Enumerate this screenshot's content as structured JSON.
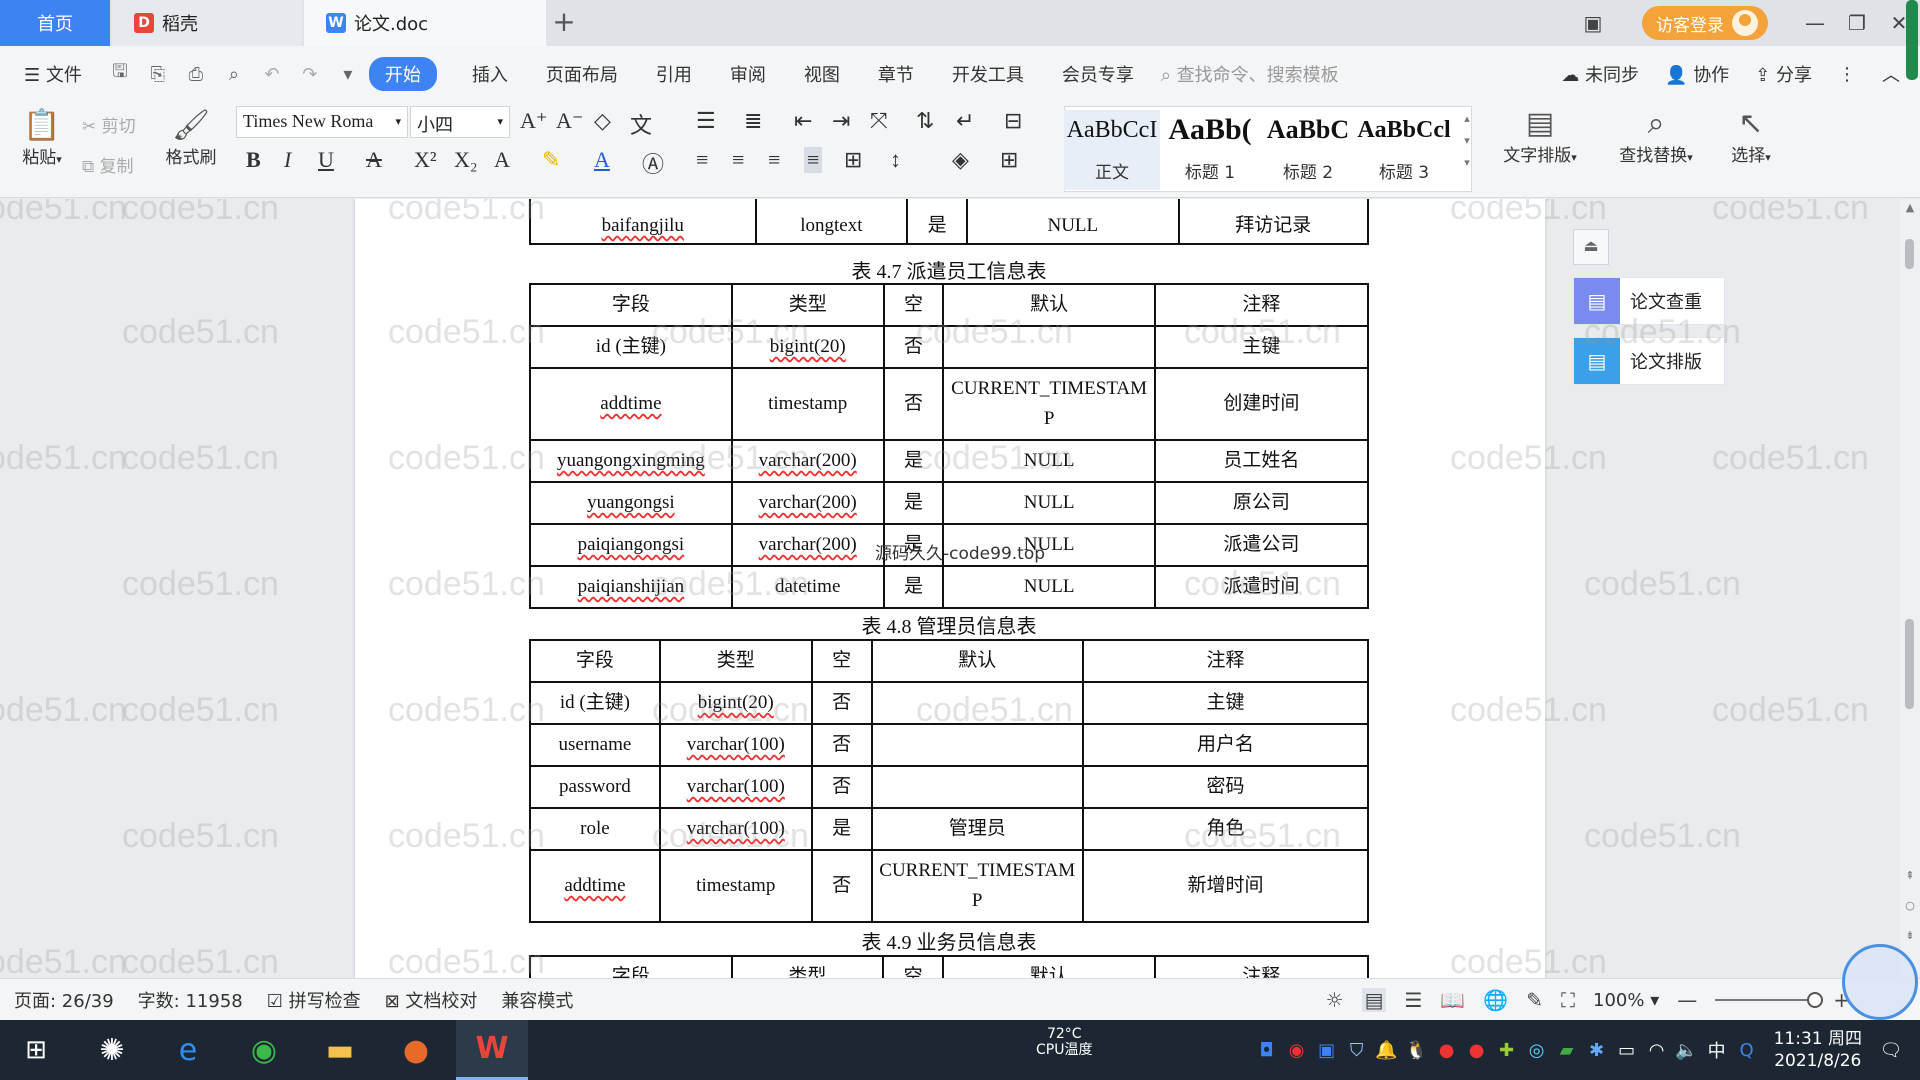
{
  "colors": {
    "accent": "#3d84f2",
    "login": "#f3a33a",
    "taskbar": "#1d2733"
  },
  "tabs": {
    "home": "首页",
    "daoke": "稻壳",
    "doc": "论文.doc",
    "new_icon": "plus-icon"
  },
  "window": {
    "login": "访客登录"
  },
  "menu": {
    "file": "文件",
    "items": [
      "开始",
      "插入",
      "页面布局",
      "引用",
      "审阅",
      "视图",
      "章节",
      "开发工具",
      "会员专享"
    ],
    "search": "查找命令、搜索模板",
    "sync": "未同步",
    "collab": "协作",
    "share": "分享"
  },
  "ribbon": {
    "paste": "粘贴",
    "cut": "剪切",
    "copy": "复制",
    "format_painter": "格式刷",
    "font_name": "Times New Roma",
    "font_size": "小四",
    "styles": [
      {
        "sample": "AaBbCcI",
        "name": "正文"
      },
      {
        "sample": "AaBb(",
        "name": "标题 1"
      },
      {
        "sample": "AaBbC",
        "name": "标题 2"
      },
      {
        "sample": "AaBbCcl",
        "name": "标题 3"
      }
    ],
    "text_layout": "文字排版",
    "find_replace": "查找替换",
    "select": "选择"
  },
  "document": {
    "watermark": "code51.cn",
    "overlay": "源码久久-code99.top",
    "top_row": [
      "baifangjilu",
      "longtext",
      "是",
      "NULL",
      "拜访记录"
    ],
    "table47": {
      "caption": "表 4.7  派遣员工信息表",
      "headers": [
        "字段",
        "类型",
        "空",
        "默认",
        "注释"
      ],
      "rows": [
        [
          "id (主键)",
          "bigint(20)",
          "否",
          "",
          "主键"
        ],
        [
          "addtime",
          "timestamp",
          "否",
          "CURRENT_TIMESTAMP",
          "创建时间"
        ],
        [
          "yuangongxingming",
          "varchar(200)",
          "是",
          "NULL",
          "员工姓名"
        ],
        [
          "yuangongsi",
          "varchar(200)",
          "是",
          "NULL",
          "原公司"
        ],
        [
          "paiqiangongsi",
          "varchar(200)",
          "是",
          "NULL",
          "派遣公司"
        ],
        [
          "paiqianshijian",
          "datetime",
          "是",
          "NULL",
          "派遣时间"
        ]
      ]
    },
    "table48": {
      "caption": "表 4.8  管理员信息表",
      "headers": [
        "字段",
        "类型",
        "空",
        "默认",
        "注释"
      ],
      "rows": [
        [
          "id (主键)",
          "bigint(20)",
          "否",
          "",
          "主键"
        ],
        [
          "username",
          "varchar(100)",
          "否",
          "",
          "用户名"
        ],
        [
          "password",
          "varchar(100)",
          "否",
          "",
          "密码"
        ],
        [
          "role",
          "varchar(100)",
          "是",
          "管理员",
          "角色"
        ],
        [
          "addtime",
          "timestamp",
          "否",
          "CURRENT_TIMESTAMP",
          "新增时间"
        ]
      ]
    },
    "table49": {
      "caption": "表 4.9  业务员信息表",
      "headers": [
        "字段",
        "类型",
        "空",
        "默认",
        "注释"
      ]
    }
  },
  "side_panel": {
    "check": "论文查重",
    "layout": "论文排版"
  },
  "status": {
    "page": "页面: 26/39",
    "words": "字数: 11958",
    "spell": "拼写检查",
    "proof": "文档校对",
    "compat": "兼容模式",
    "zoom": "100%"
  },
  "taskbar": {
    "temp": "72°C",
    "cpu": "CPU温度",
    "time": "11:31 周四",
    "date": "2021/8/26",
    "ime": "中"
  }
}
